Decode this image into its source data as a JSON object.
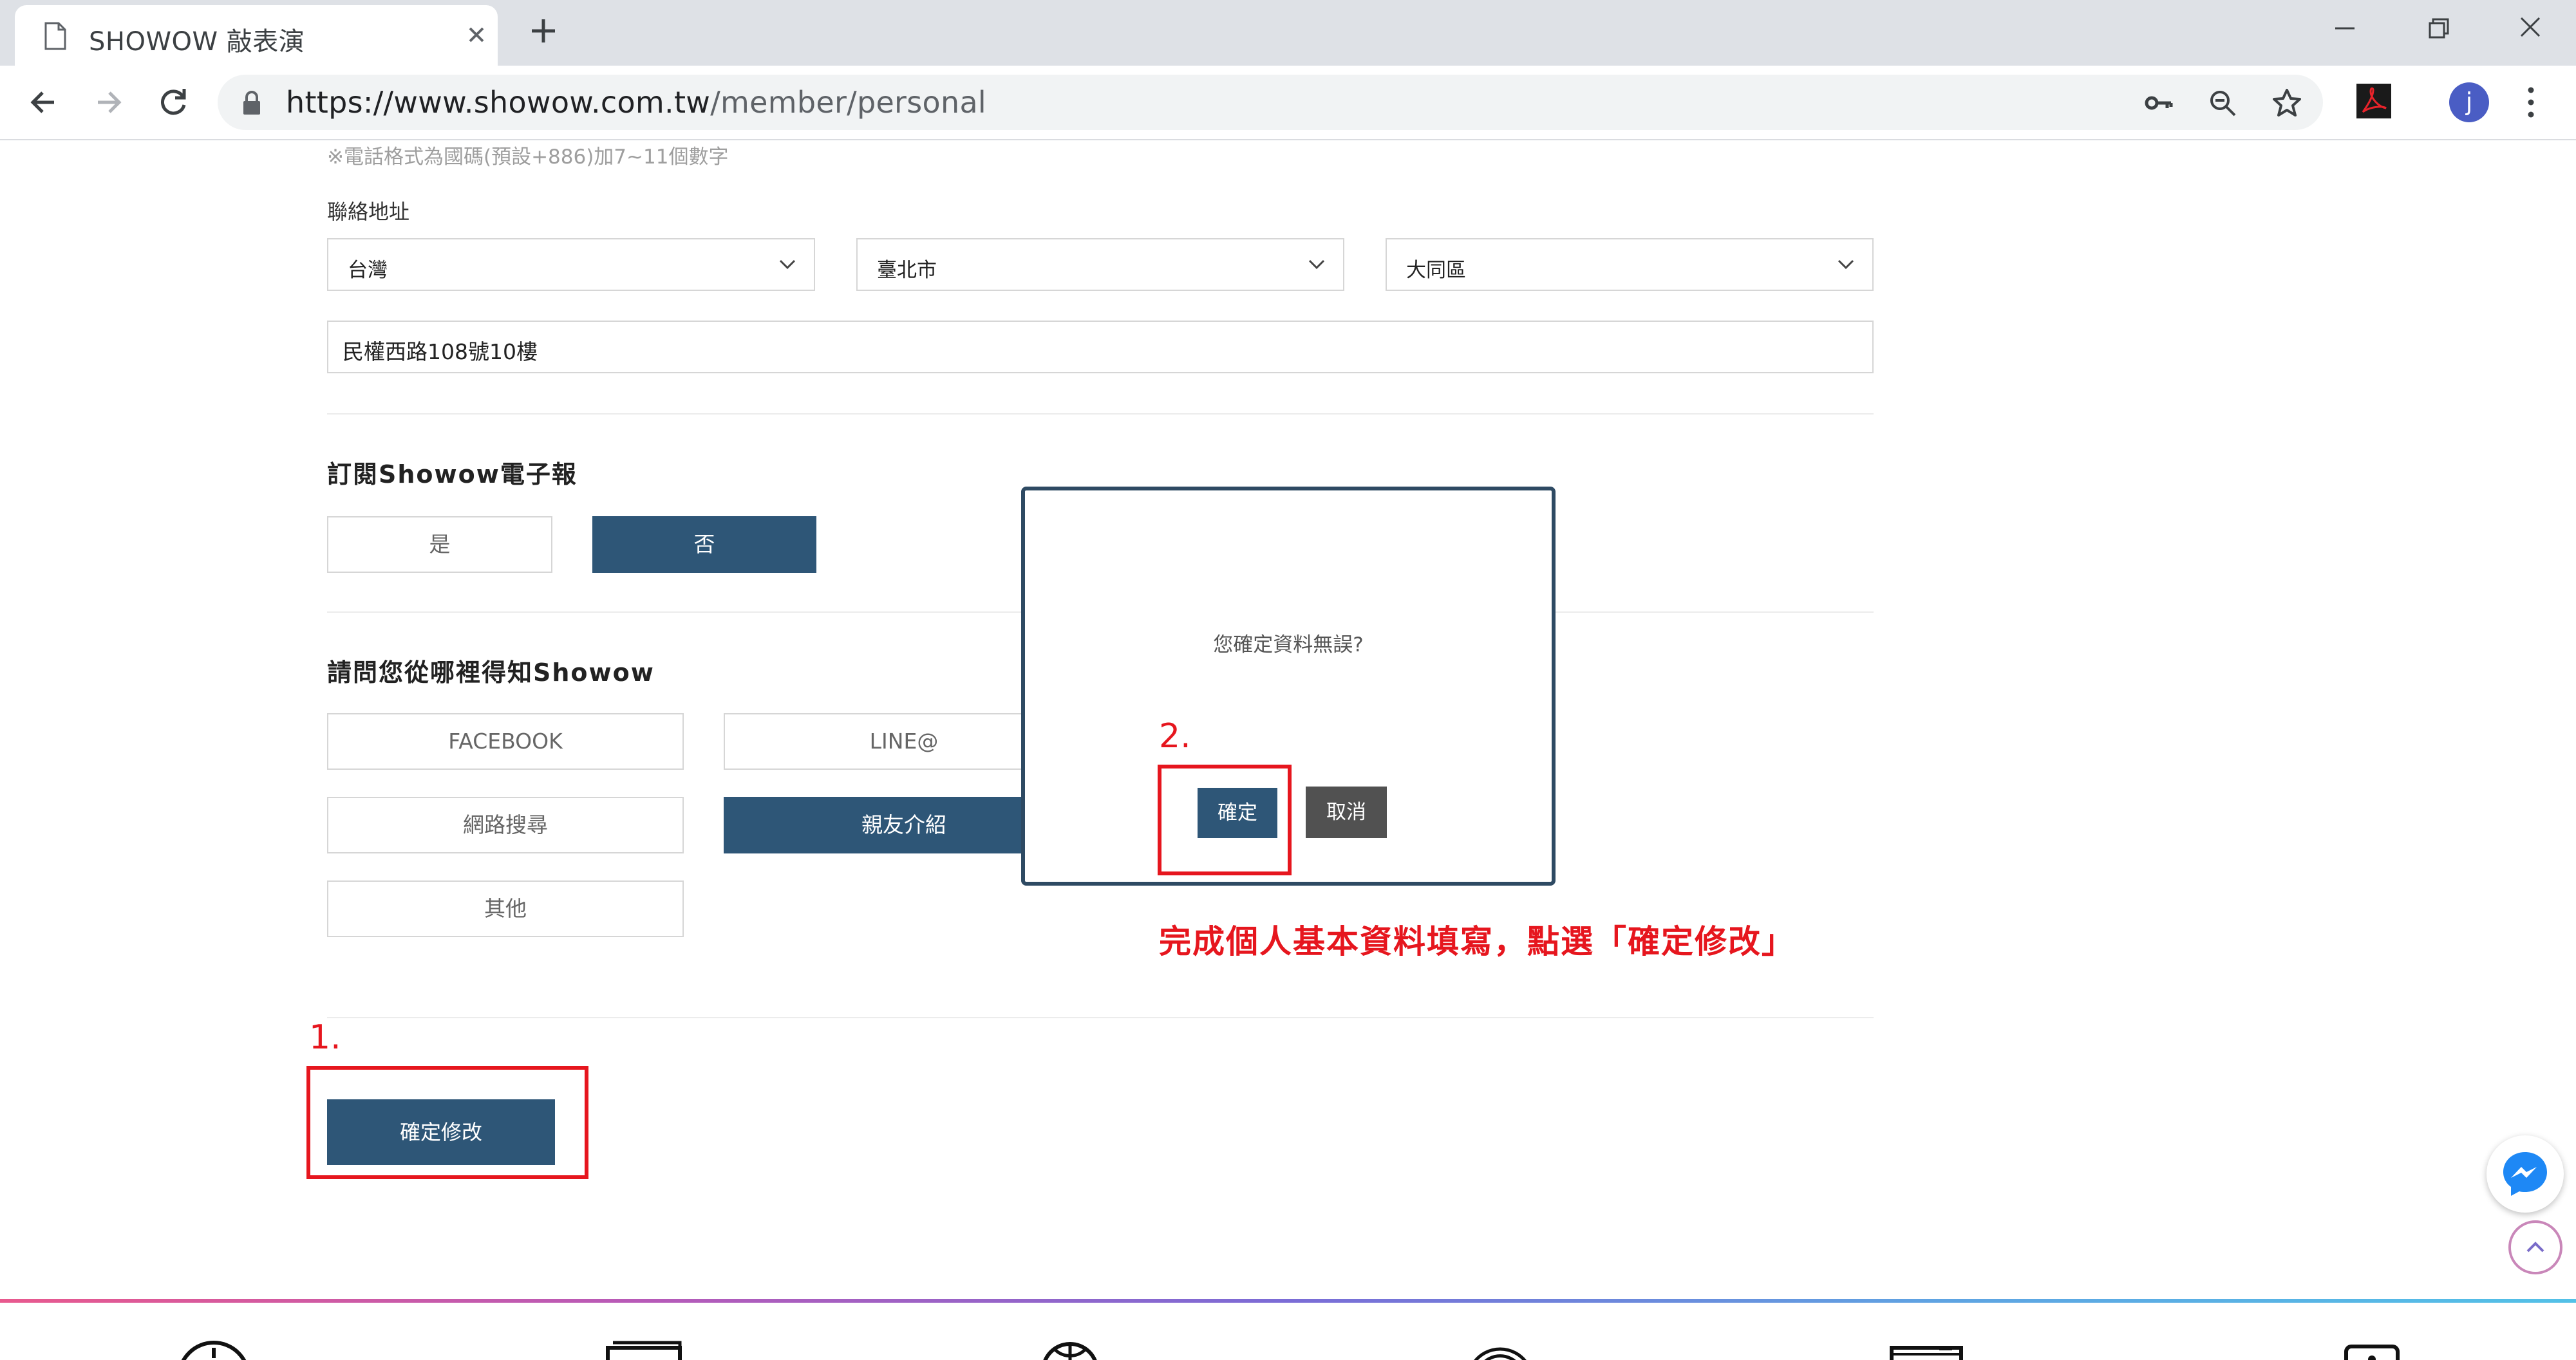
{
  "browser": {
    "tab_title": "SHOWOW 敲表演",
    "url_host": "https://www.showow.com.tw",
    "url_path": "/member/personal",
    "avatar_letter": "j"
  },
  "form": {
    "phone_note": "※電話格式為國碼(預設+886)加7~11個數字",
    "address_label": "聯絡地址",
    "country": "台灣",
    "city": "臺北市",
    "district": "大同區",
    "street": "民權西路108號10樓",
    "newsletter_title": "訂閱Showow電子報",
    "newsletter_options": [
      "是",
      "否"
    ],
    "newsletter_selected": "否",
    "source_title": "請問您從哪裡得知Showow",
    "source_options": [
      "FACEBOOK",
      "LINE@",
      "網路搜尋",
      "親友介紹",
      "其他"
    ],
    "source_selected": "親友介紹",
    "submit_label": "確定修改"
  },
  "modal": {
    "message": "您確定資料無誤?",
    "ok_label": "確定",
    "cancel_label": "取消"
  },
  "annotations": {
    "step1": "1.",
    "step2": "2.",
    "instruction": "完成個人基本資料填寫，點選「確定修改」"
  },
  "colors": {
    "primary": "#2e5677",
    "annotation_red": "#e6161e",
    "modal_border": "#2e4a63",
    "cancel_gray": "#515151"
  },
  "icons": [
    "page-icon",
    "close-icon",
    "plus-icon",
    "minimize-icon",
    "restore-icon",
    "window-close-icon",
    "back-arrow-icon",
    "forward-arrow-icon",
    "reload-icon",
    "lock-icon",
    "key-icon",
    "zoom-out-icon",
    "star-icon",
    "pdf-extension-icon",
    "more-vert-icon",
    "chevron-down-icon",
    "messenger-icon",
    "chevron-up-icon"
  ]
}
